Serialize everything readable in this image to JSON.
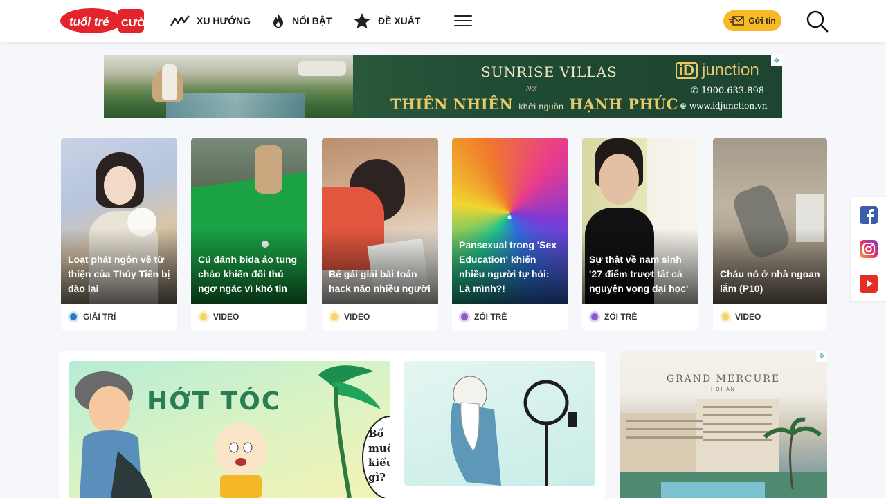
{
  "header": {
    "logo_alt": "tuổi trẻ CƯỜI",
    "nav": [
      {
        "label": "XU HƯỚNG",
        "icon": "trend-icon"
      },
      {
        "label": "NỔI BẬT",
        "icon": "fire-icon"
      },
      {
        "label": "ĐỀ XUẤT",
        "icon": "star-icon"
      }
    ],
    "send_label": "Gửi tin"
  },
  "banner_ad": {
    "brand": "SUNRISE VILLAS",
    "noi": "Nơi",
    "headline_a": "THIÊN NHIÊN",
    "headline_mid": "khởi nguồn",
    "headline_b": "HẠNH PHÚC",
    "company_mark": "iD",
    "company": "junction",
    "phone": "1900.633.898",
    "web": "www.idjunction.vn"
  },
  "cards": [
    {
      "title": "Loạt phát ngôn về từ thiện của Thủy Tiên bị đào lại",
      "category": "GIẢI TRÍ"
    },
    {
      "title": "Cú đánh bida ảo tung chảo khiến đối thủ ngơ ngác vì khó tin",
      "category": "VIDEO"
    },
    {
      "title": "Bé gái giải bài toán hack não nhiều người",
      "category": "VIDEO"
    },
    {
      "title": "Pansexual trong 'Sex Education' khiến nhiều người tự hỏi: Là mình?!",
      "category": "ZÓI TRẺ"
    },
    {
      "title": "Sự thật về nam sinh '27 điểm trượt tất cả nguyện vọng đại học'",
      "category": "ZÓI TRẺ"
    },
    {
      "title": "Cháu nó ở nhà ngoan lắm (P10)",
      "category": "VIDEO"
    }
  ],
  "comic": {
    "title_a": "HỚT TÓC",
    "bubble": "Bố muốn kiểu gì?"
  },
  "side_ad": {
    "brand": "GRAND MERCURE",
    "location": "HOI AN"
  },
  "colors": {
    "accent_red": "#e3242b",
    "send_yellow": "#f7b924"
  }
}
